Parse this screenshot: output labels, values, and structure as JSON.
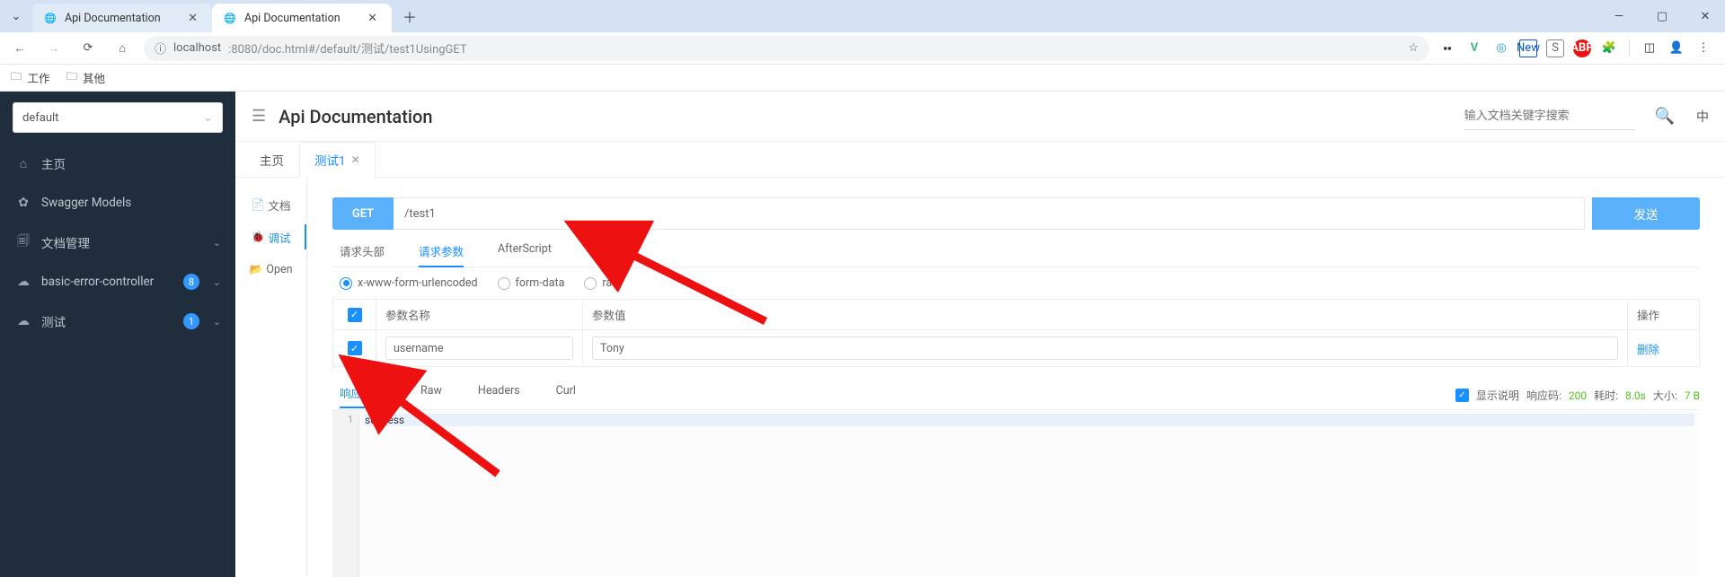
{
  "browser": {
    "tabs": [
      {
        "title": "Api Documentation",
        "active": false
      },
      {
        "title": "Api Documentation",
        "active": true
      }
    ],
    "url_host": "localhost",
    "url_rest": ":8080/doc.html#/default/测试/test1UsingGET"
  },
  "bookmarks": [
    {
      "label": "工作"
    },
    {
      "label": "其他"
    }
  ],
  "sidebar": {
    "selector_value": "default",
    "items": [
      {
        "icon": "home",
        "label": "主页"
      },
      {
        "icon": "models",
        "label": "Swagger Models"
      },
      {
        "icon": "doc",
        "label": "文档管理",
        "expandable": true
      },
      {
        "icon": "cloud",
        "label": "basic-error-controller",
        "badge": "8",
        "expandable": true
      },
      {
        "icon": "cloud",
        "label": "测试",
        "badge": "1",
        "expandable": true
      }
    ]
  },
  "header": {
    "title": "Api Documentation",
    "search_placeholder": "输入文档关键字搜索",
    "lang": "中"
  },
  "page_tabs": [
    {
      "label": "主页",
      "active": false,
      "closable": false
    },
    {
      "label": "测试1",
      "active": true,
      "closable": true
    }
  ],
  "vtabs": [
    {
      "icon": "📄",
      "label": "文档",
      "active": false
    },
    {
      "icon": "🐞",
      "label": "调试",
      "active": true
    },
    {
      "icon": "📂",
      "label": "Open",
      "active": false
    }
  ],
  "request": {
    "method": "GET",
    "path": "/test1",
    "send_label": "发送",
    "req_tabs": [
      {
        "label": "请求头部",
        "active": false
      },
      {
        "label": "请求参数",
        "active": true
      },
      {
        "label": "AfterScript",
        "active": false
      }
    ],
    "body_types": [
      {
        "label": "x-www-form-urlencoded",
        "checked": true
      },
      {
        "label": "form-data",
        "checked": false
      },
      {
        "label": "raw",
        "checked": false
      }
    ],
    "param_headers": {
      "name": "参数名称",
      "value": "参数值",
      "ops": "操作"
    },
    "params": [
      {
        "enabled": true,
        "name": "username",
        "value": "Tony",
        "delete_label": "删除"
      }
    ]
  },
  "response": {
    "tabs": [
      {
        "label": "响应内容",
        "active": true
      },
      {
        "label": "Raw",
        "active": false
      },
      {
        "label": "Headers",
        "active": false
      },
      {
        "label": "Curl",
        "active": false
      }
    ],
    "meta": {
      "show_desc_label": "显示说明",
      "code_label": "响应码:",
      "code": "200",
      "time_label": "耗时:",
      "time": "8.0s",
      "size_label": "大小:",
      "size": "7 B"
    },
    "body_lines": [
      {
        "n": "1",
        "text": "success"
      }
    ]
  }
}
